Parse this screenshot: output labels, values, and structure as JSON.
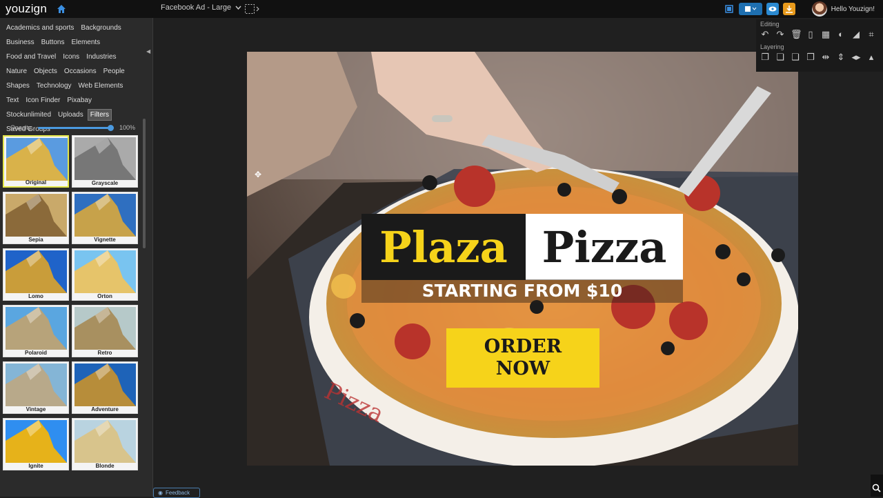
{
  "header": {
    "logo": "youzign",
    "document_select": "Facebook Ad - Large",
    "greeting": "Hello Youzign!",
    "icons": [
      "home-icon",
      "chevron-down-icon",
      "crop-icon",
      "fullscreen-icon",
      "save-icon",
      "preview-icon",
      "download-icon",
      "avatar"
    ]
  },
  "sidebar": {
    "categories": [
      "Academics and sports",
      "Backgrounds",
      "Business",
      "Buttons",
      "Elements",
      "Food and Travel",
      "Icons",
      "Industries",
      "Nature",
      "Objects",
      "Occasions",
      "People",
      "Shapes",
      "Technology",
      "Web Elements",
      "Text",
      "Icon Finder",
      "Pixabay",
      "Stockunlimited",
      "Uploads",
      "Filters",
      "Saved Groups"
    ],
    "active_category": "Filters",
    "opacity": {
      "label": "Opacity",
      "value": "100%"
    },
    "filters": [
      "Original",
      "Grayscale",
      "Sepia",
      "Vignette",
      "Lomo",
      "Orton",
      "Polaroid",
      "Retro",
      "Vintage",
      "Adventure",
      "Ignite",
      "Blonde"
    ]
  },
  "design": {
    "title_part1": "Plaza",
    "title_part2": "Pizza",
    "subtitle": "STARTING FROM $10",
    "cta_line1": "ORDER",
    "cta_line2": "NOW"
  },
  "panel": {
    "editing_label": "Editing",
    "layering_label": "Layering"
  },
  "footer": {
    "feedback": "Feedback"
  },
  "colors": {
    "accent_yellow": "#f6d31a",
    "dark": "#1a1a1a",
    "toolbar_blue": "#1e6fb0",
    "download_orange": "#e89a1c"
  }
}
